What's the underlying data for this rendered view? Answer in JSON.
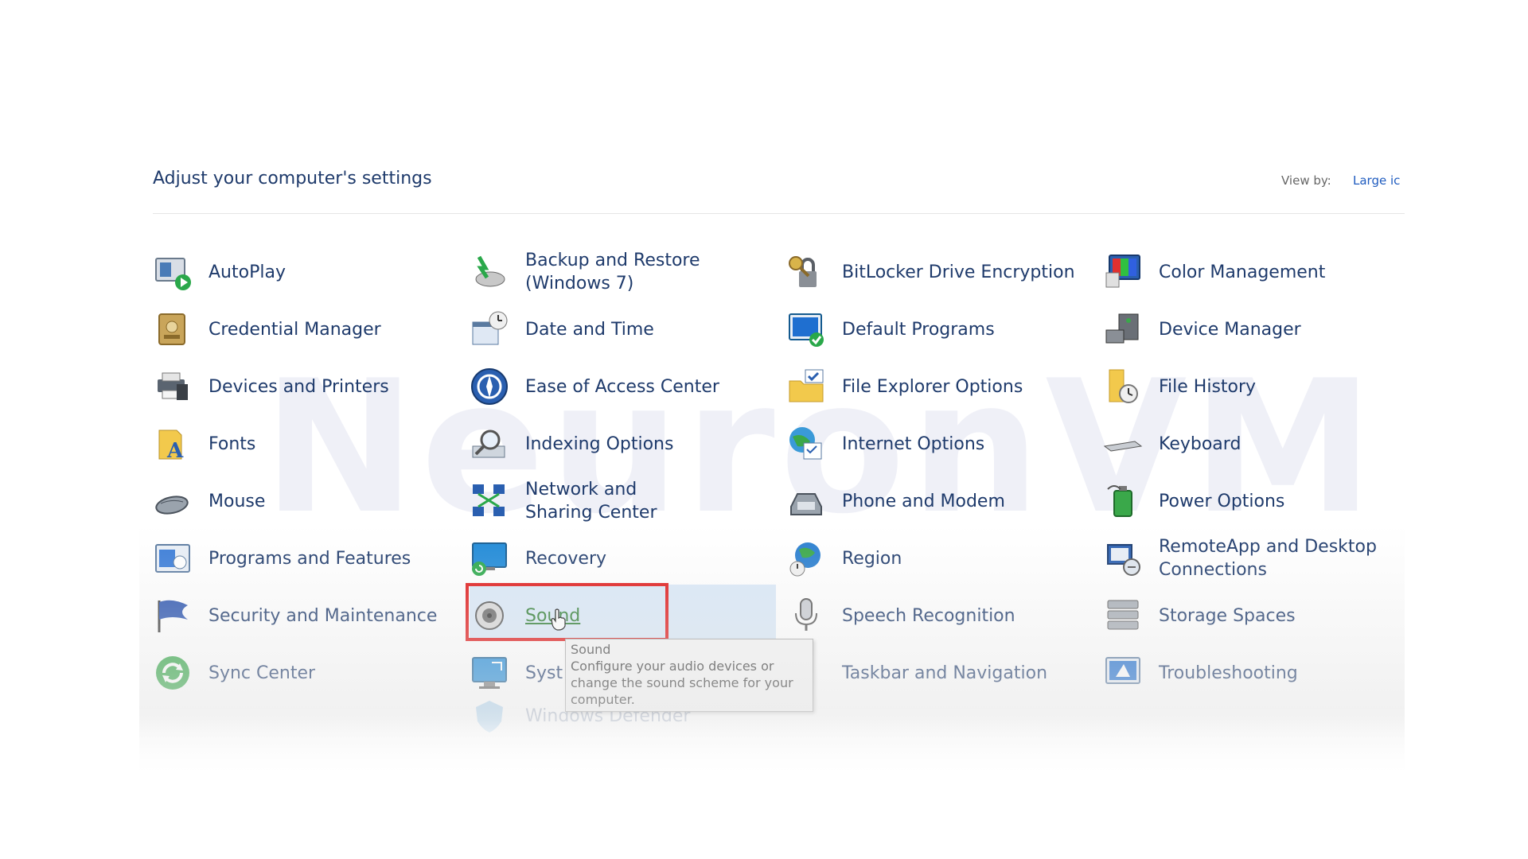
{
  "header": {
    "title": "Adjust your computer's settings",
    "view_by_label": "View by:",
    "view_by_value": "Large ic"
  },
  "watermark": "NeuronVM",
  "items": {
    "autoplay": "AutoPlay",
    "backup": "Backup and Restore (Windows 7)",
    "bitlocker": "BitLocker Drive Encryption",
    "color": "Color Management",
    "credential": "Credential Manager",
    "datetime": "Date and Time",
    "default_programs": "Default Programs",
    "device_manager": "Device Manager",
    "devices_printers": "Devices and Printers",
    "ease": "Ease of Access Center",
    "file_explorer": "File Explorer Options",
    "file_history": "File History",
    "fonts": "Fonts",
    "indexing": "Indexing Options",
    "internet": "Internet Options",
    "keyboard": "Keyboard",
    "mouse": "Mouse",
    "network": "Network and Sharing Center",
    "phone": "Phone and Modem",
    "power": "Power Options",
    "programs": "Programs and Features",
    "recovery": "Recovery",
    "region": "Region",
    "remoteapp": "RemoteApp and Desktop Connections",
    "security": "Security and Maintenance",
    "sound": "Sound",
    "speech": "Speech Recognition",
    "storage": "Storage Spaces",
    "sync": "Sync Center",
    "system": "Syst",
    "taskbar": "Taskbar and Navigation",
    "troubleshooting": "Troubleshooting",
    "defender": "Windows Defender"
  },
  "tooltip": {
    "title": "Sound",
    "body": "Configure your audio devices or change the sound scheme for your computer."
  }
}
